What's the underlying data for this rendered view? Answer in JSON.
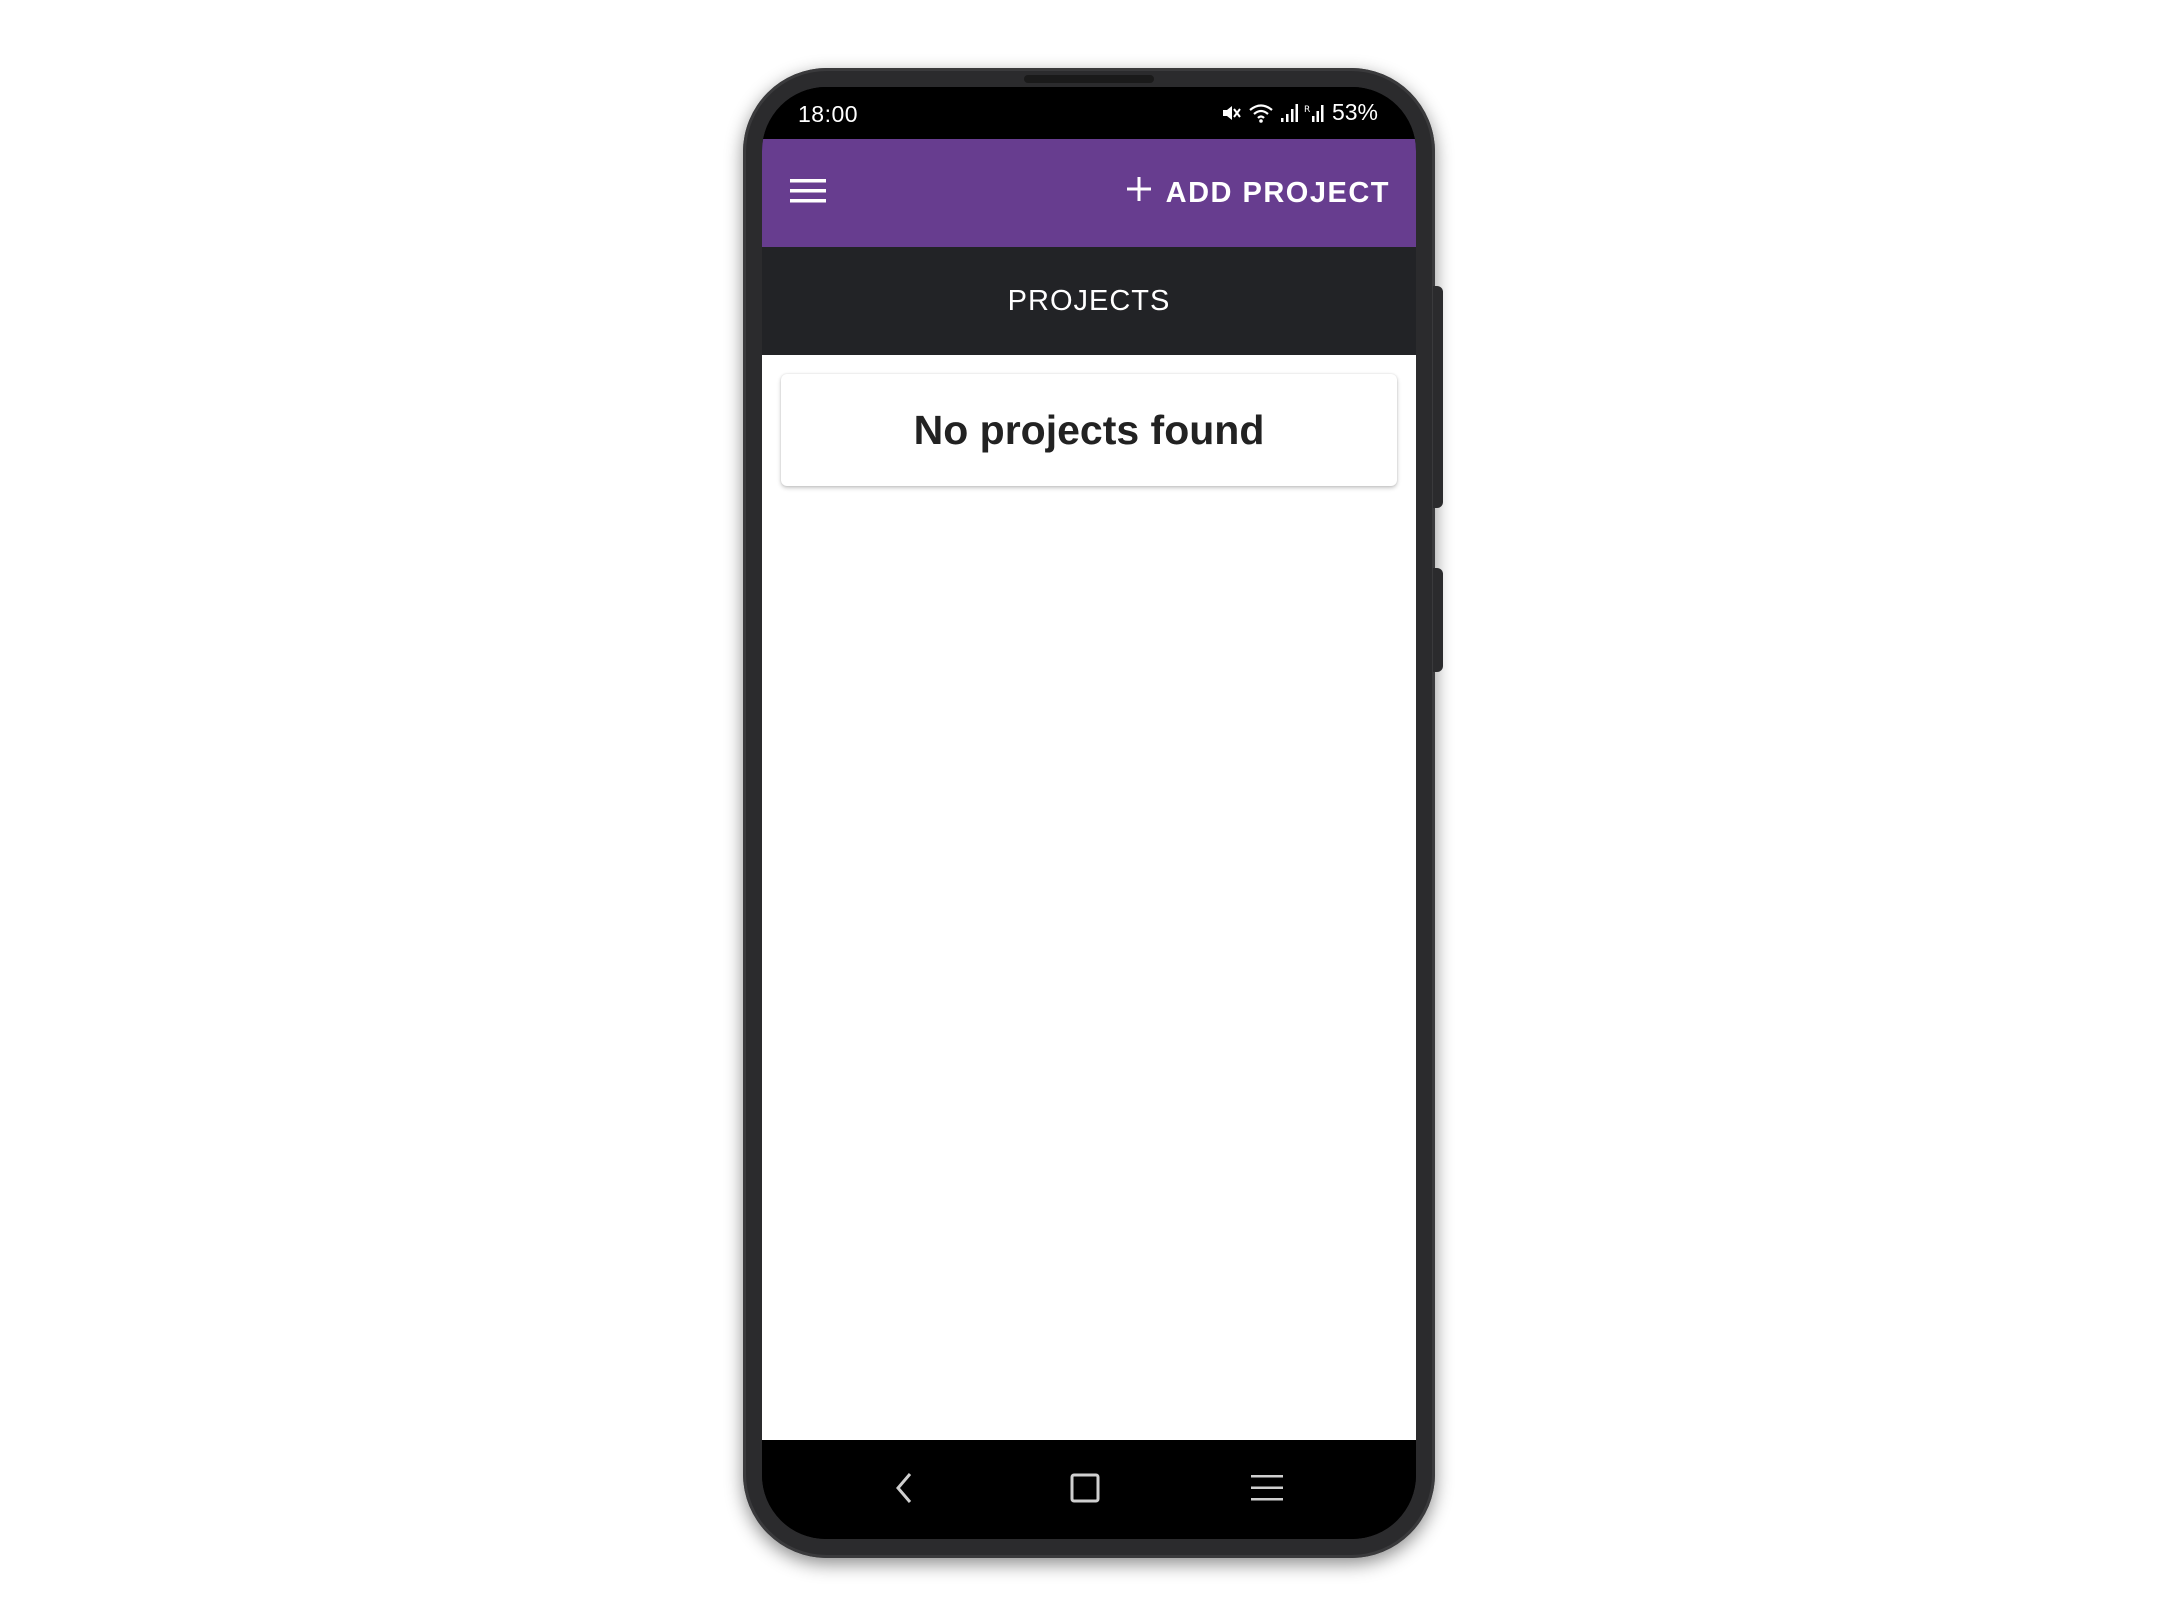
{
  "status_bar": {
    "time": "18:00",
    "battery": "53%",
    "icons": [
      "mute-icon",
      "wifi-icon",
      "signal-icon",
      "signal-icon"
    ]
  },
  "app_bar": {
    "menu_icon": "hamburger-menu-icon",
    "add_icon": "plus-icon",
    "add_label": "ADD PROJECT",
    "color": "#673d8f"
  },
  "sub_header": {
    "title": "PROJECTS",
    "color": "#222326"
  },
  "main": {
    "empty_message": "No projects found"
  },
  "nav_bar": {
    "back_icon": "back-icon",
    "home_icon": "home-icon",
    "recents_icon": "recents-icon"
  }
}
